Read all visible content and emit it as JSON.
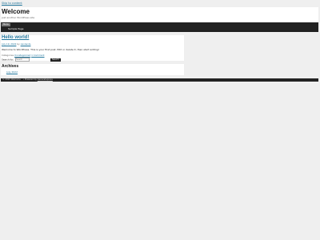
{
  "skip_link": "Skip to content",
  "header": {
    "title": "Welcome",
    "description": "Just another WordPress site"
  },
  "nav": {
    "toggle_label": "Menu",
    "items": [
      {
        "label": "Sample Page"
      }
    ]
  },
  "post": {
    "title": "Hello world!",
    "date": "July 19, 2022",
    "author_prefix": "by",
    "author": "reinlands",
    "content": "Welcome to WordPress. This is your first post. Edit or delete it, then start writing!",
    "categories_prefix": "Categories",
    "category": "Uncategorized",
    "comments": "1 Comment"
  },
  "search": {
    "label": "Search for:",
    "placeholder": "Search",
    "button": "Search"
  },
  "archives": {
    "title": "Archives",
    "items": [
      {
        "label": "July 2022"
      }
    ]
  },
  "footer": {
    "copyright": "© 2022 Welcome",
    "powered_prefix": "• Powered by",
    "theme": "Generatepress"
  }
}
